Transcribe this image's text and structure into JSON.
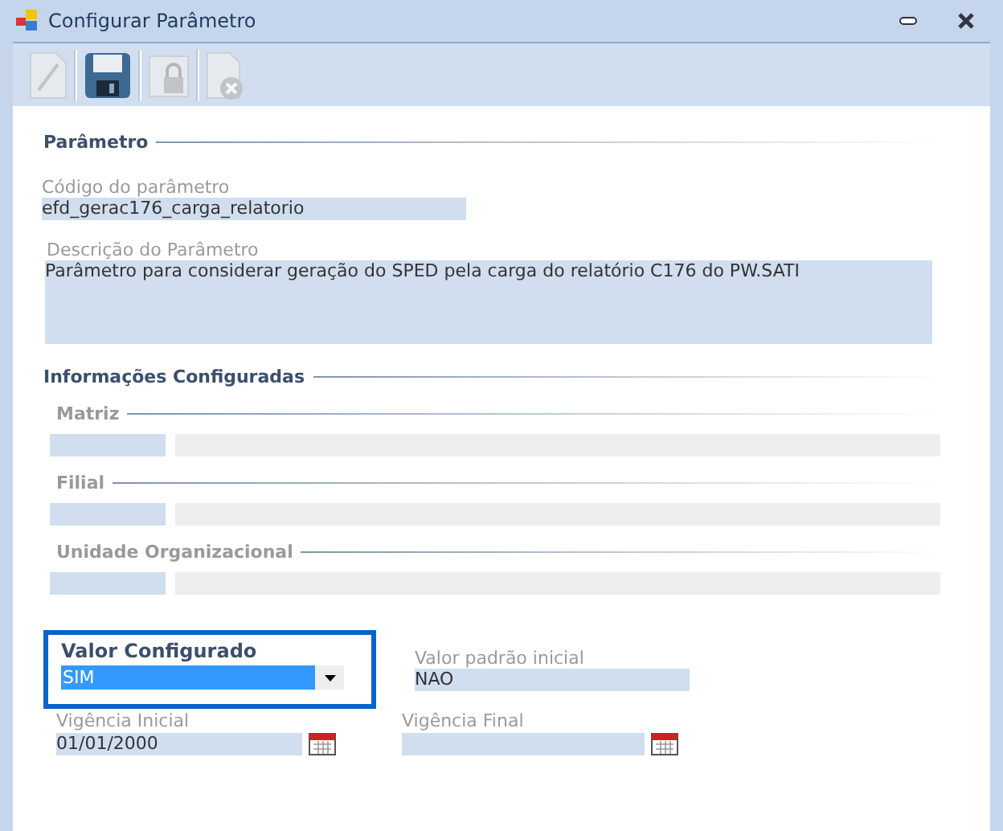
{
  "window": {
    "title": "Configurar Parâmetro"
  },
  "toolbar": [
    {
      "kind": "new",
      "disabled": true
    },
    {
      "kind": "save",
      "disabled": false
    },
    {
      "kind": "lock",
      "disabled": true
    },
    {
      "kind": "delete",
      "disabled": true
    }
  ],
  "parametro": {
    "title": "Parâmetro",
    "code_label": "Código do parâmetro",
    "code_value": "efd_gerac176_carga_relatorio",
    "description_label": "Descrição do Parâmetro",
    "description_value": "Parâmetro para considerar geração do SPED pela carga do relatório C176 do PW.SATI"
  },
  "informacoes": {
    "title": "Informações Configuradas",
    "groups": [
      {
        "title": "Matriz"
      },
      {
        "title": "Filial"
      },
      {
        "title": "Unidade Organizacional"
      }
    ]
  },
  "valor_configurado": {
    "label": "Valor Configurado",
    "value": "SIM",
    "focused": true
  },
  "valor_padrao": {
    "label": "Valor padrão inicial",
    "value": "NAO"
  },
  "vigencia_inicial": {
    "label": "Vigência Inicial",
    "value": "01/01/2000"
  },
  "vigencia_final": {
    "label": "Vigência Final"
  }
}
